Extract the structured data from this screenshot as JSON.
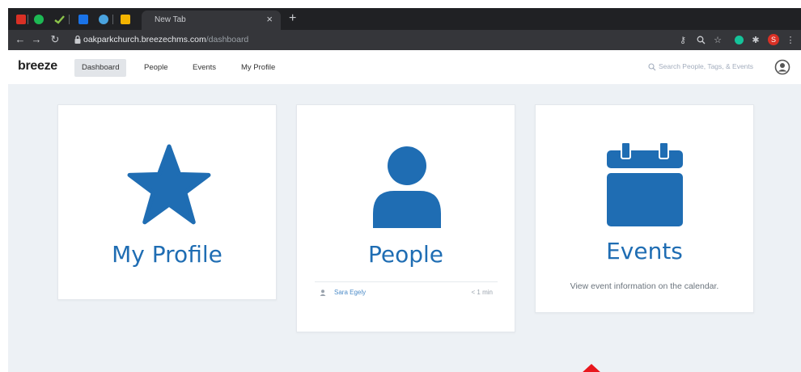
{
  "browser": {
    "active_tab_title": "New Tab",
    "new_tab_symbol": "+",
    "url_host": "oakparkchurch.breezechms.com",
    "url_path": "/dashboard",
    "profile_initial": "S",
    "colors": {
      "tabstrip": "#202124",
      "toolbar": "#35363a"
    },
    "pinned_tabs": [
      {
        "icon": "gmail-icon",
        "color": "#d93025"
      },
      {
        "icon": "spotify-icon",
        "color": "#1db954"
      },
      {
        "icon": "check-icon",
        "color": "#8bc34a"
      },
      {
        "icon": "breeze-icon",
        "color": "#1a73e8"
      },
      {
        "icon": "app-icon",
        "color": "#4aa3df"
      },
      {
        "icon": "notes-icon",
        "color": "#f4b400"
      }
    ]
  },
  "app": {
    "logo": "breeze",
    "nav": [
      {
        "label": "Dashboard",
        "active": true
      },
      {
        "label": "People",
        "active": false
      },
      {
        "label": "Events",
        "active": false
      },
      {
        "label": "My Profile",
        "active": false
      }
    ],
    "search_placeholder": "Search People, Tags, & Events",
    "accent_color": "#1f6db3"
  },
  "cards": {
    "profile": {
      "title": "My Profile",
      "icon": "star-icon"
    },
    "people": {
      "title": "People",
      "icon": "person-icon",
      "feed": [
        {
          "name": "Sara Egely",
          "time": "< 1 min"
        }
      ]
    },
    "events": {
      "title": "Events",
      "icon": "calendar-icon",
      "description": "View event information on the calendar."
    }
  }
}
